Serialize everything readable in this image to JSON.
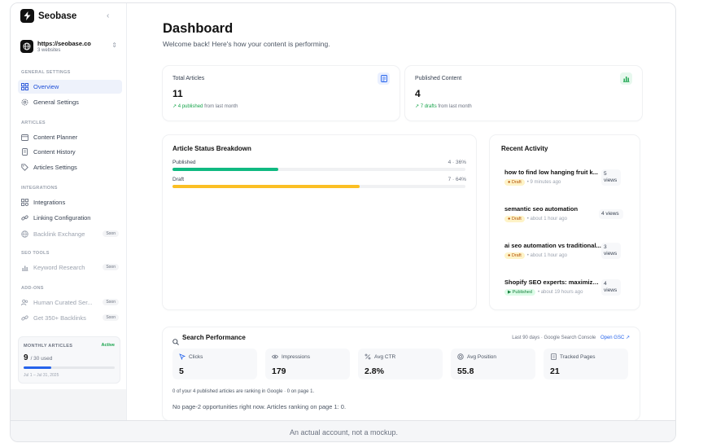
{
  "brand": {
    "name": "Seobase",
    "collapse_icon": "chevron-left-icon"
  },
  "site": {
    "url": "https://seobase.co",
    "sub": "3 websites"
  },
  "sidebar": {
    "sections": {
      "general": "GENERAL SETTINGS",
      "articles": "ARTICLES",
      "integrations": "INTEGRATIONS",
      "seo_tools": "SEO TOOLS",
      "addons": "ADD-ONS"
    },
    "items": {
      "overview": "Overview",
      "general_settings": "General Settings",
      "content_planner": "Content Planner",
      "content_history": "Content History",
      "articles_settings": "Articles Settings",
      "integrations": "Integrations",
      "linking_configuration": "Linking Configuration",
      "backlink_exchange": "Backlink Exchange",
      "keyword_research": "Keyword Research",
      "human_curated": "Human Curated Ser...",
      "get_backlinks": "Get 350+ Backlinks"
    },
    "soon_label": "Soon",
    "monthly": {
      "title": "MONTHLY ARTICLES",
      "badge": "Active",
      "count": "9",
      "used": "/ 30 used",
      "progress": 0.3,
      "date": "Jul 1 – Jul 31, 2025"
    }
  },
  "main": {
    "title": "Dashboard",
    "subtitle": "Welcome back! Here's how your content is performing.",
    "total_articles": {
      "label": "Total Articles",
      "value": "11",
      "delta": "4 published",
      "delta_suffix": "from last month"
    },
    "published_content": {
      "label": "Published Content",
      "value": "4",
      "delta": "7 drafts",
      "delta_suffix": "from last month"
    },
    "status_breakdown": {
      "title": "Article Status Breakdown",
      "rows": [
        {
          "label": "Published",
          "value": "4 · 36%",
          "fraction": 0.36,
          "color": "#10b981"
        },
        {
          "label": "Draft",
          "value": "7 · 64%",
          "fraction": 0.64,
          "color": "#fbbf24"
        }
      ]
    },
    "recent_activity": {
      "title": "Recent Activity",
      "items": [
        {
          "title": "how to find low hanging fruit k...",
          "status": "Draft",
          "time": "• 9 minutes ago",
          "views": "5 views"
        },
        {
          "title": "semantic seo automation",
          "status": "Draft",
          "time": "• about 1 hour ago",
          "views": "4 views"
        },
        {
          "title": "ai seo automation vs traditional...",
          "status": "Draft",
          "time": "• about 1 hour ago",
          "views": "3 views"
        },
        {
          "title": "Shopify SEO experts: maximize ...",
          "status": "Published",
          "time": "• about 19 hours ago",
          "views": "4 views"
        }
      ]
    },
    "search_performance": {
      "title": "Search Performance",
      "range": "Last 90 days · Google Search Console",
      "open_label": "Open GSC",
      "metrics": [
        {
          "label": "Clicks",
          "value": "5",
          "icon": "cursor-icon"
        },
        {
          "label": "Impressions",
          "value": "179",
          "icon": "eye-icon"
        },
        {
          "label": "Avg CTR",
          "value": "2.8%",
          "icon": "percent-icon"
        },
        {
          "label": "Avg Position",
          "value": "55.8",
          "icon": "target-icon"
        },
        {
          "label": "Tracked Pages",
          "value": "21",
          "icon": "document-icon"
        }
      ],
      "note": "0 of your 4 published articles are ranking in Google · 0 on page 1.",
      "note2": "No page-2 opportunities right now. Articles ranking on page 1: 0."
    }
  },
  "footer": {
    "text": "An actual account, not a mockup."
  },
  "colors": {
    "accent": "#2563eb",
    "success": "#16a34a",
    "warning": "#f59e0b"
  }
}
